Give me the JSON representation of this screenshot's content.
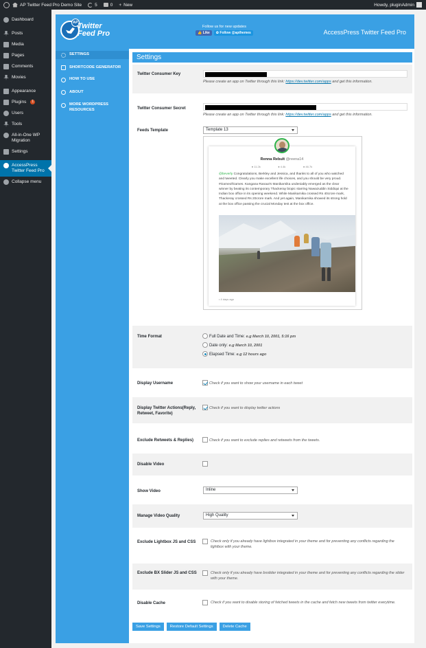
{
  "admin_bar": {
    "site_name": "AP Twitter Feed Pro Demo Site",
    "updates_count": "5",
    "comments_count": "0",
    "new_label": "New",
    "howdy": "Howdy, pluginAdmin"
  },
  "sidebar": {
    "items": [
      {
        "label": "Dashboard",
        "icon": "dashboard-icon"
      },
      {
        "label": "Posts",
        "icon": "pin-icon"
      },
      {
        "label": "Media",
        "icon": "media-icon"
      },
      {
        "label": "Pages",
        "icon": "pages-icon"
      },
      {
        "label": "Comments",
        "icon": "comments-icon"
      },
      {
        "label": "Movies",
        "icon": "pin-icon"
      },
      {
        "label": "Appearance",
        "icon": "brush-icon"
      },
      {
        "label": "Plugins",
        "icon": "plugin-icon",
        "badge": "1"
      },
      {
        "label": "Users",
        "icon": "users-icon"
      },
      {
        "label": "Tools",
        "icon": "tools-icon"
      },
      {
        "label": "All-in-One WP Migration",
        "icon": "migration-icon"
      },
      {
        "label": "Settings",
        "icon": "settings-icon"
      },
      {
        "label": "AccessPress Twitter Feed Pro",
        "icon": "twitter-icon",
        "active": true
      },
      {
        "label": "Collapse menu",
        "icon": "collapse-icon"
      }
    ]
  },
  "banner": {
    "logo_ap": "AP",
    "logo_line1": "Twitter",
    "logo_line2": "Feed Pro",
    "follow_text": "Follow us for new updates",
    "like_label": "Like",
    "follow_label": "Follow @apthemes",
    "title": "AccessPress Twitter Feed Pro"
  },
  "plugin_nav": {
    "items": [
      {
        "label": "Settings",
        "icon": "gear-icon",
        "active": true
      },
      {
        "label": "Shortcode Generator",
        "icon": "code-icon"
      },
      {
        "label": "How to use",
        "icon": "help-icon"
      },
      {
        "label": "About",
        "icon": "info-icon"
      },
      {
        "label": "More WordPress Resources",
        "icon": "wordpress-icon"
      }
    ]
  },
  "settings": {
    "heading": "Settings",
    "consumer_key": {
      "label": "Twitter Consumer Key",
      "hint_prefix": "Please create an app on Twitter through this link:",
      "link": "https://dev.twitter.com/apps",
      "hint_suffix": "and get this information."
    },
    "consumer_secret": {
      "label": "Twitter Consumer Secret",
      "hint_prefix": "Please create an app on Twitter through this link:",
      "link": "https://dev.twitter.com/apps",
      "hint_suffix": "and get this information."
    },
    "feeds_template": {
      "label": "Feeds Template",
      "value": "Template 13"
    },
    "preview": {
      "name": "Renna Rebult",
      "handle": "@reena14",
      "stat1": "● 11.2k",
      "stat2": "● 4.4k",
      "stat3": "● 46.7k",
      "mention": "@beverly",
      "text": " Congratulations, Berkley and Jessica, and thanks to all of you who watched and tweeted. Clearly you make excellent life choices, and you should be very proud. #GameofGames. Kangana Ranaut's Manikarnika undeniably emerged as the clear winner by beating its contemporary Thackeray biopic starring Nawazuddin Siddiqui at the Indian box office in its opening weekend. While Manikarnika crossed Rs 40crore mark, Thackeray crossed Rs 20crore mark. And yet again, Manikarnika showed its strong hold at the box office passing the crucial Monday test at the box office.",
      "time": "• 4 days ago"
    },
    "time_format": {
      "label": "Time Format",
      "options": [
        {
          "label": "Full Date and Time:",
          "example": "e.g March 10, 2001, 5:16 pm",
          "checked": false
        },
        {
          "label": "Date only:",
          "example": "e.g March 10, 2001",
          "checked": false
        },
        {
          "label": "Elapsed Time:",
          "example": "e.g 12 hours ago",
          "checked": true
        }
      ]
    },
    "display_username": {
      "label": "Display Username",
      "hint": "Check if you want to show your username in each tweet",
      "checked": true
    },
    "display_actions": {
      "label": "Display Twitter Actions(Reply, Retweet, Favorite)",
      "hint": "Check if you want to display twitter actions",
      "checked": true
    },
    "exclude_retweets": {
      "label": "Exclude Retweets & Replies)",
      "hint": "Check if you want to exclude replies and retweets from the tweets.",
      "checked": false
    },
    "disable_video": {
      "label": "Disable Video",
      "checked": false
    },
    "show_video": {
      "label": "Show Video",
      "value": "Inline"
    },
    "video_quality": {
      "label": "Manage Video Quality",
      "value": "High Quality"
    },
    "exclude_lightbox": {
      "label": "Exclude Lightbox JS and CSS",
      "hint": "Check only if you already have lightbox integrated in your theme and for preventing any conflicts regarding the lightbox with your theme.",
      "checked": false
    },
    "exclude_bxslider": {
      "label": "Exclude BX Slider JS and CSS",
      "hint": "Check only if you already have bxslider integrated in your theme and for preventing any conflicts regarding the slider with your theme.",
      "checked": false
    },
    "disable_cache": {
      "label": "Disable Cache",
      "hint": "Check if you want to disable storing of fetched tweets in the cache and fetch new tweets from twitter everytime.",
      "checked": false
    }
  },
  "buttons": {
    "save": "Save Settings",
    "restore": "Restore Default Settings",
    "delete_cache": "Delete Cache"
  }
}
